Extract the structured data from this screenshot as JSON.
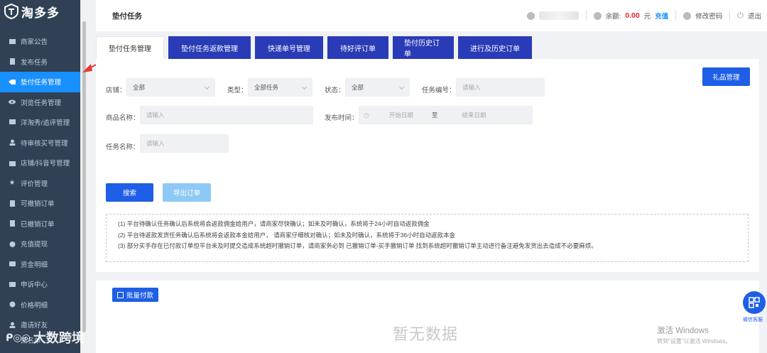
{
  "brand": {
    "name": "淘多多"
  },
  "sidebar": {
    "items": [
      {
        "label": "商家公告",
        "icon": "notice-icon"
      },
      {
        "label": "发布任务",
        "icon": "publish-icon"
      },
      {
        "label": "垫付任务管理",
        "icon": "task-icon",
        "active": true
      },
      {
        "label": "浏览任务管理",
        "icon": "eye-icon"
      },
      {
        "label": "洋淘秀/追评管理",
        "icon": "comment-icon"
      },
      {
        "label": "待审核买号管理",
        "icon": "user-icon"
      },
      {
        "label": "店铺/抖音号管理",
        "icon": "shop-icon"
      },
      {
        "label": "评价管理",
        "icon": "star-icon"
      },
      {
        "label": "可撤销订单",
        "icon": "order-icon"
      },
      {
        "label": "已撤销订单",
        "icon": "cancel-icon"
      },
      {
        "label": "充值提现",
        "icon": "money-bag-icon"
      },
      {
        "label": "资金明细",
        "icon": "wallet-icon"
      },
      {
        "label": "申诉中心",
        "icon": "appeal-icon"
      },
      {
        "label": "价格明细",
        "icon": "price-icon"
      },
      {
        "label": "邀请好友",
        "icon": "invite-icon"
      },
      {
        "label": "黑名单",
        "icon": "blacklist-icon"
      }
    ]
  },
  "header": {
    "title": "垫付任务",
    "balance_label": "余额:",
    "balance_value": "0.00",
    "balance_unit": "元",
    "recharge": "充值",
    "change_password": "修改密码",
    "logout": "退出"
  },
  "tabs": [
    {
      "label": "垫付任务管理",
      "active": true
    },
    {
      "label": "垫付任务返款管理"
    },
    {
      "label": "快递单号管理"
    },
    {
      "label": "待好评订单"
    },
    {
      "label": "垫付历史订单"
    },
    {
      "label": "进行及历史订单"
    }
  ],
  "filters": {
    "shop_label": "店铺：",
    "shop_value": "全部",
    "type_label": "类型：",
    "type_value": "全部任务",
    "status_label": "状态：",
    "status_value": "全部",
    "task_no_label": "任务编号：",
    "task_no_placeholder": "请输入",
    "product_label": "商品名称：",
    "product_placeholder": "请输入",
    "publish_time_label": "发布时间：",
    "start_date": "开始日期",
    "to": "至",
    "end_date": "结束日期",
    "task_name_label": "任务名称：",
    "task_name_placeholder": "请输入"
  },
  "buttons": {
    "gift": "礼品管理",
    "search": "搜索",
    "export": "导出订单",
    "batch_pay": "批量付款"
  },
  "notices": [
    "(1)  平台待确认任务确认后系统将会返款佣金给用户，请商家尽快确认；如未及时确认，系统将于24小时自动返款佣金",
    "(2)  平台待返款发货任务确认后系统将会返款本金给用户，  请商家仔细核对确认；如未及时确认，系统将于36小时自动返款本金",
    "(3)  部分买手存在已付款订单但平台未及时提交造成系统超时撤销订单，请商家务必到 已撤销订单-买手撤销订单 找到系统超时撤销订单主动进行备注避免发货出去造成不必要麻烦。"
  ],
  "empty": "暂无数据",
  "windows": {
    "title": "激活 Windows",
    "sub": "转到\"设置\"以激活 Windows。"
  },
  "wechat": {
    "label": "微信客服"
  },
  "watermark": "大数跨境"
}
